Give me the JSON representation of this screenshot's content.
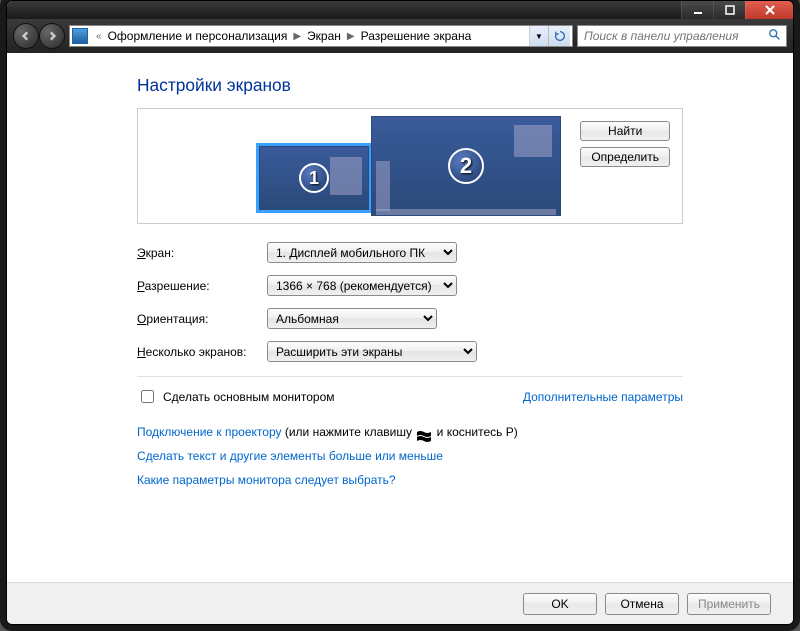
{
  "breadcrumb": {
    "part1": "Оформление и персонализация",
    "part2": "Экран",
    "part3": "Разрешение экрана"
  },
  "search": {
    "placeholder": "Поиск в панели управления"
  },
  "page": {
    "title": "Настройки экранов"
  },
  "preview": {
    "monitor1_number": "1",
    "monitor2_number": "2",
    "find_btn": "Найти",
    "detect_btn": "Определить"
  },
  "form": {
    "screen_label": "Экран:",
    "screen_value": "1. Дисплей мобильного ПК",
    "resolution_label": "Разрешение:",
    "resolution_value": "1366 × 768 (рекомендуется)",
    "orientation_label": "Ориентация:",
    "orientation_value": "Альбомная",
    "multi_label": "Несколько экранов:",
    "multi_value": "Расширить эти экраны"
  },
  "options": {
    "make_primary": "Сделать основным монитором",
    "advanced": "Дополнительные параметры"
  },
  "links": {
    "projector_pre": "Подключение к проектору",
    "projector_post1": " (или нажмите клавишу ",
    "projector_post2": " и коснитесь P)",
    "textsize": "Сделать текст и другие элементы больше или меньше",
    "whichmon": "Какие параметры монитора следует выбрать?"
  },
  "footer": {
    "ok": "OK",
    "cancel": "Отмена",
    "apply": "Применить"
  }
}
